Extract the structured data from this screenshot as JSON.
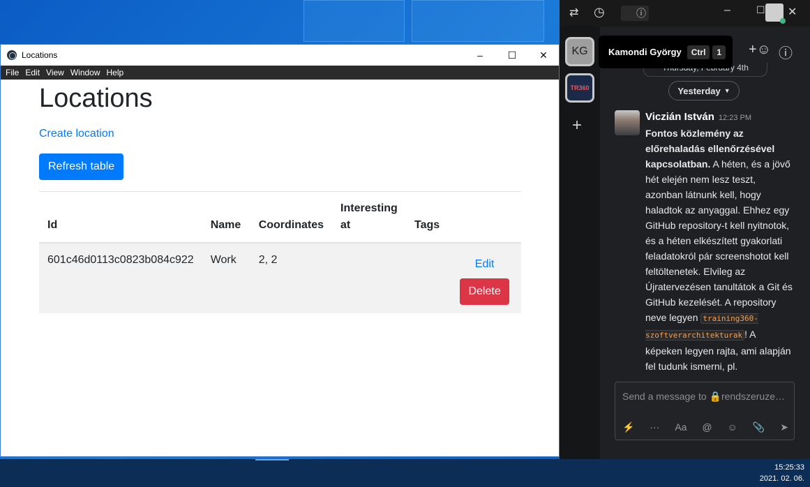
{
  "desktop": {
    "clock_time": "15:25:33",
    "clock_date": "2021. 02. 06."
  },
  "app": {
    "window_title": "Locations",
    "menu": [
      "File",
      "Edit",
      "View",
      "Window",
      "Help"
    ],
    "page_title": "Locations",
    "create_link": "Create location",
    "refresh_button": "Refresh table",
    "table": {
      "headers": [
        "Id",
        "Name",
        "Coordinates",
        "Interesting at",
        "Tags"
      ],
      "rows": [
        {
          "id": "601c46d0113c0823b084c922",
          "name": "Work",
          "coordinates": "2, 2",
          "interesting_at": "",
          "tags": "",
          "edit_label": "Edit",
          "delete_label": "Delete"
        }
      ]
    }
  },
  "chat": {
    "tooltip_name": "Kamondi György",
    "tooltip_key": "Ctrl",
    "tooltip_num": "1",
    "server_kg": "KG",
    "server_tr": "TR360",
    "prev_date": "Thursday, February 4th",
    "date_pill": "Yesterday",
    "message": {
      "author": "Viczián István",
      "time": "12:23 PM",
      "bold_text": "Fontos közlemény az előrehaladás ellenőrzésével kapcsolatban.",
      "text_1": " A héten, és a jövő hét elején nem lesz teszt, azonban látnunk kell, hogy haladtok az anyaggal. Ehhez egy GitHub repository-t kell nyitnotok, és a héten elkészített gyakorlati feladatokról pár screenshotot kell feltöltenetek. Elvileg az Újratervezésen tanultátok a Git és GitHub kezelését. A repository neve legyen ",
      "code": "training360-szoftverarchitekturak",
      "text_2": "! A képeken legyen rajta, ami alapján fel tudunk ismerni, pl."
    },
    "composer_placeholder": "Send a message to 🔒rendszeruze…",
    "composer_tools": [
      "⚡",
      "···",
      "Aa",
      "@",
      "☺",
      "📎",
      "➤"
    ]
  }
}
